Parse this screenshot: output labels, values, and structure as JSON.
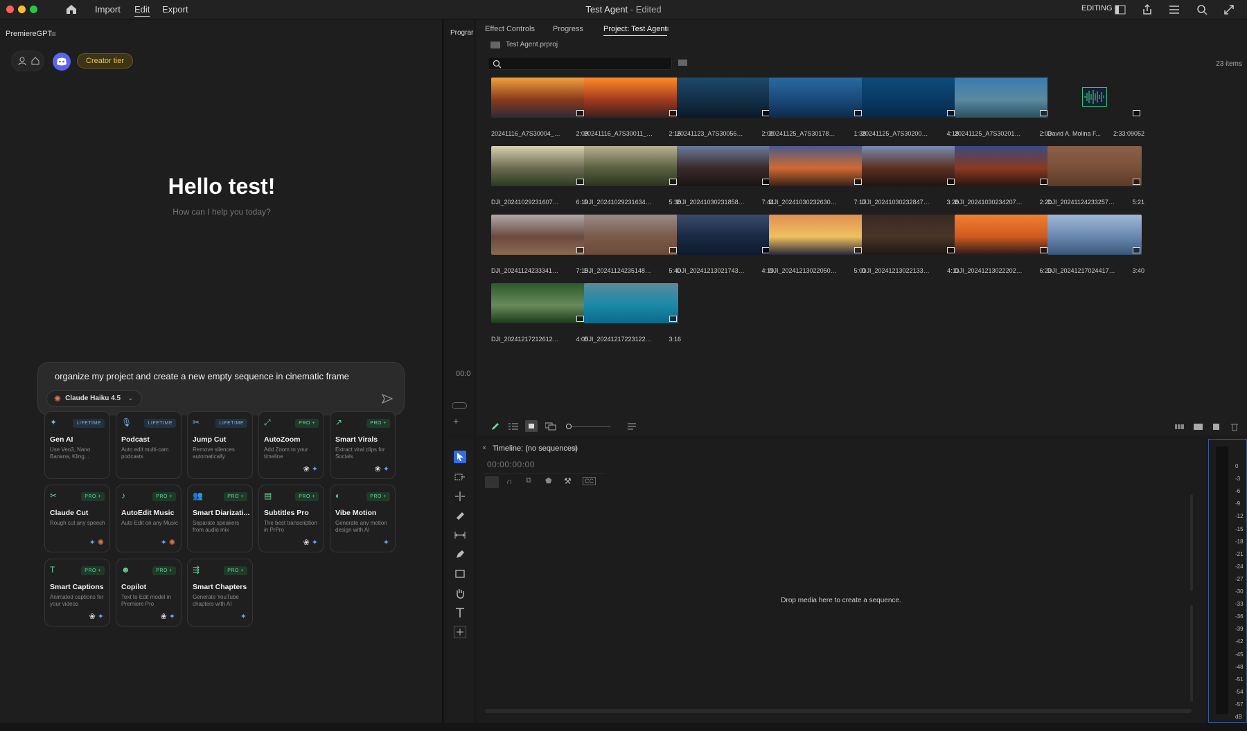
{
  "window": {
    "title": "Test Agent",
    "title_suffix": " - Edited",
    "menu": [
      "Import",
      "Edit",
      "Export"
    ],
    "workspace_label": "EDITING"
  },
  "left_panel": {
    "title": "PremiereGPT",
    "tier_badge": "Creator tier",
    "greeting": "Hello test!",
    "subtitle": "How can I help you today?",
    "prompt_value": "organize my project and create a new empty sequence in cinematic frame",
    "model_label": "Claude Haiku 4.5",
    "cards": [
      {
        "name": "Gen AI",
        "badge": "LIFETIME",
        "desc": "Use Veo3, Nano Banana, Kling...",
        "icon": "sparkle-icon"
      },
      {
        "name": "Podcast",
        "badge": "LIFETIME",
        "desc": "Auto edit multi-cam podcasts",
        "icon": "microphone-icon"
      },
      {
        "name": "Jump Cut",
        "badge": "LIFETIME",
        "desc": "Remove silences automatically",
        "icon": "scissors-icon"
      },
      {
        "name": "AutoZoom",
        "badge": "PRO +",
        "desc": "Add Zoom to your timeline",
        "icon": "zoom-icon"
      },
      {
        "name": "Smart Virals",
        "badge": "PRO +",
        "desc": "Extract viral clips for Socials",
        "icon": "trend-icon"
      },
      {
        "name": "Claude Cut",
        "badge": "PRO +",
        "desc": "Rough cut any speech",
        "icon": "scissors-icon"
      },
      {
        "name": "AutoEdit Music",
        "badge": "PRO +",
        "desc": "Auto Edit on any Music",
        "icon": "music-note-icon"
      },
      {
        "name": "Smart Diarizati...",
        "badge": "PRO +",
        "desc": "Separate speakers from audio mix",
        "icon": "users-icon"
      },
      {
        "name": "Subtitles Pro",
        "badge": "PRO +",
        "desc": "The best transcription in PrPro",
        "icon": "subtitles-icon"
      },
      {
        "name": "Vibe Motion",
        "badge": "PRO +",
        "desc": "Generate any motion design with AI",
        "icon": "motion-icon"
      },
      {
        "name": "Smart Captions",
        "badge": "PRO +",
        "desc": "Animated captions for your videos",
        "icon": "text-icon"
      },
      {
        "name": "Copilot",
        "badge": "PRO +",
        "desc": "Text to Edit model in Premiere Pro",
        "icon": "robot-icon"
      },
      {
        "name": "Smart Chapters",
        "badge": "PRO +",
        "desc": "Generate YouTube chapters with AI",
        "icon": "chapters-icon"
      }
    ]
  },
  "program_panel": {
    "tab_label": "Prograr",
    "timecode": "00:0"
  },
  "project_panel": {
    "tabs": [
      "Effect Controls",
      "Progress",
      "Project: Test Agent"
    ],
    "file_name": "Test Agent.prproj",
    "item_count": "23 items",
    "clips": [
      {
        "name": "20241116_A7S30004_0...",
        "dur": "2:09",
        "colors": [
          "#f0a040",
          "#8a3a1a",
          "#2a2a3a"
        ]
      },
      {
        "name": "20241116_A7S30011_0...",
        "dur": "2:15",
        "colors": [
          "#ff8c2a",
          "#a33a20",
          "#3a2020"
        ]
      },
      {
        "name": "20241123_A7S30056_0...",
        "dur": "2:00",
        "colors": [
          "#1d4a6a",
          "#123048",
          "#0a1a28"
        ]
      },
      {
        "name": "20241125_A7S30178_0...",
        "dur": "1:38",
        "colors": [
          "#2a6aa0",
          "#1a4a7a",
          "#0d2a4a"
        ]
      },
      {
        "name": "20241125_A7S30200_0...",
        "dur": "4:18",
        "colors": [
          "#0e4a7a",
          "#0a3a64",
          "#06284a"
        ]
      },
      {
        "name": "20241125_A7S30201_0...",
        "dur": "2:03",
        "colors": [
          "#3a7ab0",
          "#5a8aa0",
          "#2a5060"
        ]
      },
      {
        "name": "David A. Molina  F...",
        "dur": "2:33:09052",
        "colors": [
          "#1e1e1e",
          "#1e1e1e",
          "#1e1e1e"
        ]
      },
      {
        "name": "DJI_20241029231607_0...",
        "dur": "6:19",
        "colors": [
          "#d8d0b0",
          "#6a6a50",
          "#2a3a20"
        ]
      },
      {
        "name": "DJI_20241029231634_0...",
        "dur": "5:38",
        "colors": [
          "#b8b090",
          "#5a6040",
          "#2a3320"
        ]
      },
      {
        "name": "DJI_20241030231858_0...",
        "dur": "7:44",
        "colors": [
          "#6a7a9a",
          "#3a2a2a",
          "#1a1414"
        ]
      },
      {
        "name": "DJI_20241030232630_0...",
        "dur": "7:17",
        "colors": [
          "#4a5a8a",
          "#d06a30",
          "#3a2018"
        ]
      },
      {
        "name": "DJI_20241030232847_0...",
        "dur": "3:28",
        "colors": [
          "#7a8ab0",
          "#5a3020",
          "#201410"
        ]
      },
      {
        "name": "DJI_20241030234207_0...",
        "dur": "2:21",
        "colors": [
          "#3a4a80",
          "#8a3a20",
          "#2a1410"
        ]
      },
      {
        "name": "DJI_20241124233257_0...",
        "dur": "5:21",
        "colors": [
          "#8a6048",
          "#7a5038",
          "#5a3a28"
        ]
      },
      {
        "name": "DJI_20241124233341_0...",
        "dur": "7:15",
        "colors": [
          "#b0a8a8",
          "#6a4a40",
          "#8a6a50"
        ]
      },
      {
        "name": "DJI_20241124235148_0...",
        "dur": "5:40",
        "colors": [
          "#9a8a88",
          "#7a5a48",
          "#6a4a38"
        ]
      },
      {
        "name": "DJI_20241213021743_0...",
        "dur": "4:19",
        "colors": [
          "#3a4a6a",
          "#1a2a44",
          "#0e1a2e"
        ]
      },
      {
        "name": "DJI_20241213022050_0...",
        "dur": "5:01",
        "colors": [
          "#e09050",
          "#f0c060",
          "#2a2a3a"
        ]
      },
      {
        "name": "DJI_20241213022133_0...",
        "dur": "4:11",
        "colors": [
          "#3a2a24",
          "#4a3428",
          "#1e1814"
        ]
      },
      {
        "name": "DJI_20241213022202_0...",
        "dur": "6:23",
        "colors": [
          "#f08030",
          "#d05a20",
          "#2a1a1a"
        ]
      },
      {
        "name": "DJI_20241217024417_0...",
        "dur": "3:40",
        "colors": [
          "#a0b8d8",
          "#6a88b0",
          "#3a5878"
        ]
      },
      {
        "name": "DJI_20241217212612_0...",
        "dur": "4:05",
        "colors": [
          "#2a5a2a",
          "#6a8a5a",
          "#1a3a1a"
        ]
      },
      {
        "name": "DJI_20241217223122_0...",
        "dur": "3:16",
        "colors": [
          "#5a8a9a",
          "#1a8aa8",
          "#0a6a8a"
        ]
      }
    ]
  },
  "timeline": {
    "title": "Timeline: (no sequences)",
    "timecode": "00:00:00:00",
    "drop_hint": "Drop media here to create a sequence."
  },
  "meter_labels": [
    "0",
    "-3",
    "-6",
    "-9",
    "-12",
    "-15",
    "-18",
    "-21",
    "-24",
    "-27",
    "-30",
    "-33",
    "-36",
    "-39",
    "-42",
    "-45",
    "-48",
    "-51",
    "-54",
    "-57",
    "dB"
  ],
  "colors": {
    "accent": "#2d6ef0",
    "tier": "#e6c659",
    "pro": "#6fd39a",
    "lifetime": "#7ab3d8"
  }
}
